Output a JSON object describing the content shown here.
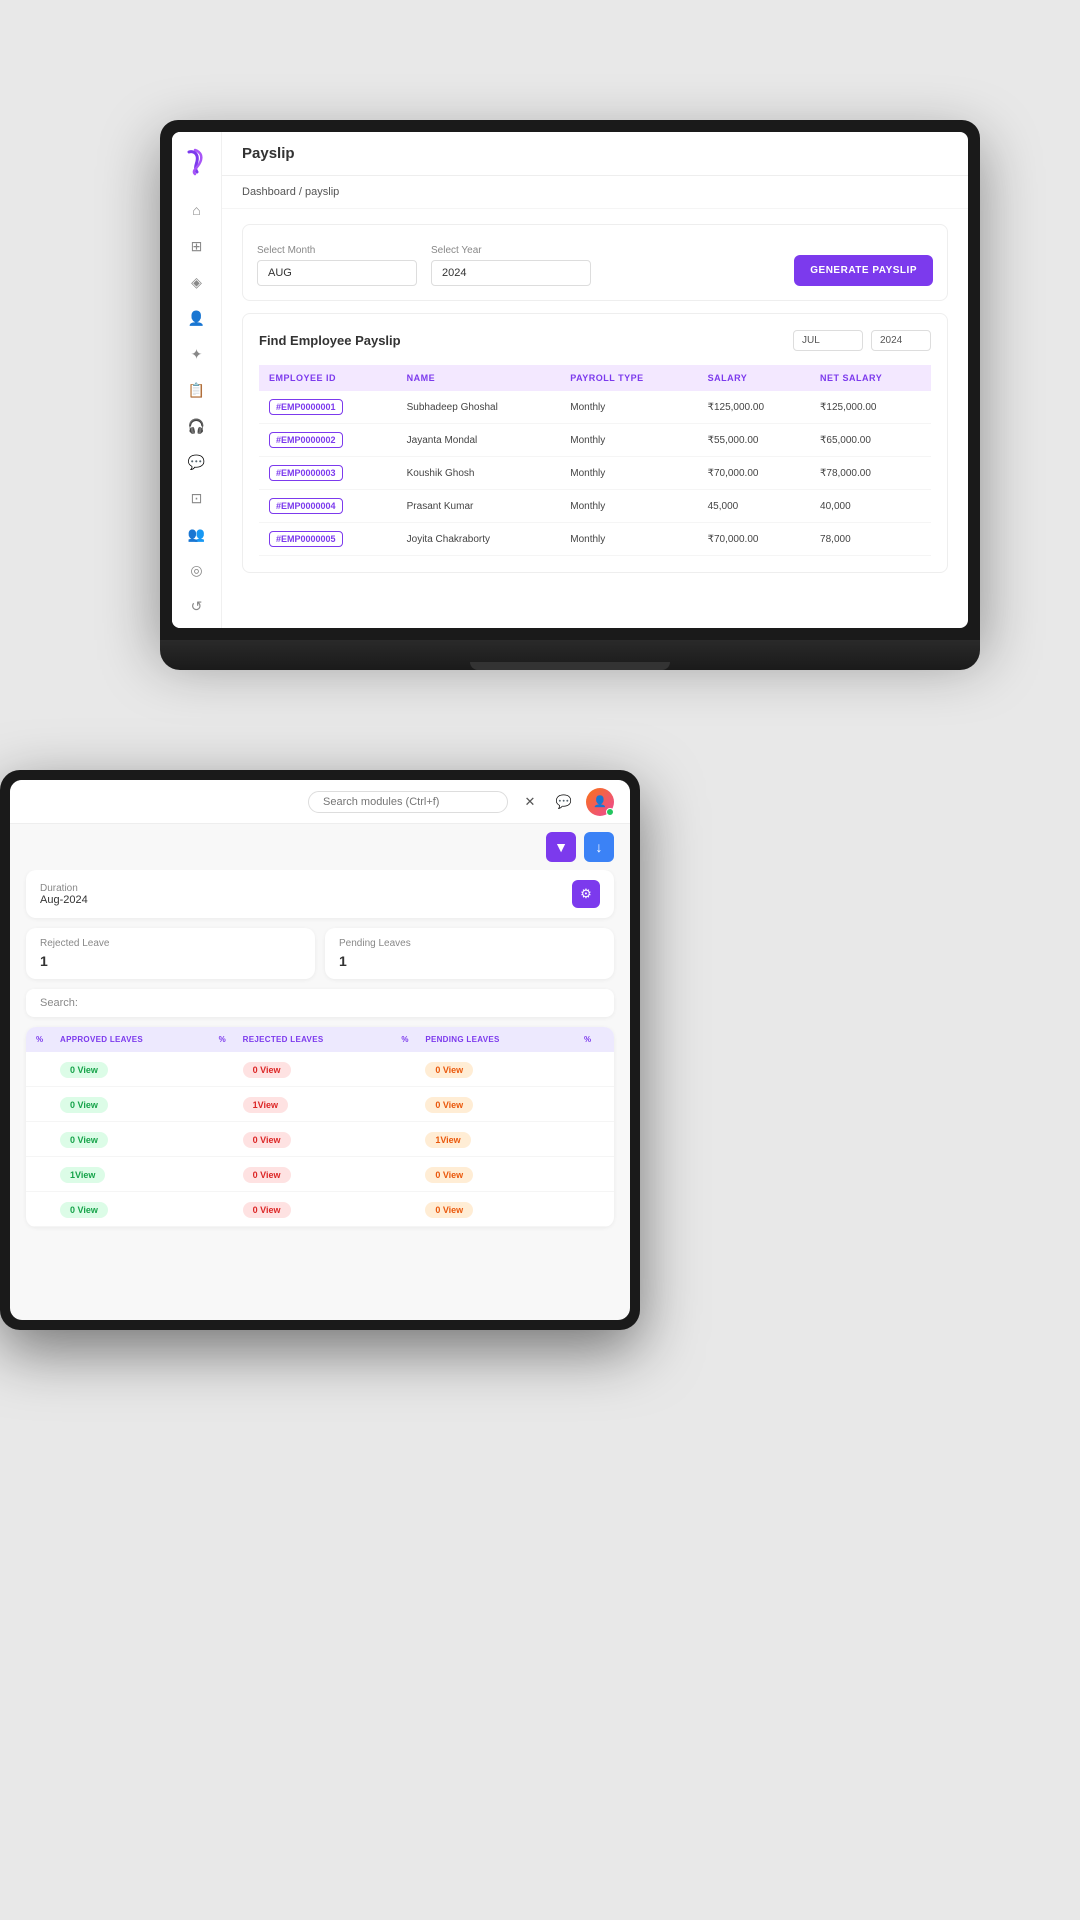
{
  "laptop": {
    "title": "Payslip",
    "breadcrumb": {
      "home": "Dashboard",
      "separator": "/",
      "current": "payslip"
    },
    "filters": {
      "select_month_label": "Select Month",
      "select_year_label": "Select Year",
      "month_value": "AUG",
      "year_value": "2024",
      "generate_btn": "GENERATE PAYSLIP"
    },
    "payslip_section": {
      "title": "Find Employee Payslip",
      "filter_month": "JUL",
      "filter_year": "2024"
    },
    "table": {
      "columns": [
        "EMPLOYEE ID",
        "NAME",
        "PAYROLL TYPE",
        "SALARY",
        "NET SALARY"
      ],
      "rows": [
        {
          "id": "#EMP0000001",
          "name": "Subhadeep Ghoshal",
          "type": "Monthly",
          "salary": "₹125,000.00",
          "net": "₹125,000.00"
        },
        {
          "id": "#EMP0000002",
          "name": "Jayanta Mondal",
          "type": "Monthly",
          "salary": "₹55,000.00",
          "net": "₹65,000.00"
        },
        {
          "id": "#EMP0000003",
          "name": "Koushik Ghosh",
          "type": "Monthly",
          "salary": "₹70,000.00",
          "net": "₹78,000.00"
        },
        {
          "id": "#EMP0000004",
          "name": "Prasant Kumar",
          "type": "Monthly",
          "salary": "45,000",
          "net": "40,000"
        },
        {
          "id": "#EMP0000005",
          "name": "Joyita Chakraborty",
          "type": "Monthly",
          "salary": "₹70,000.00",
          "net": "78,000"
        }
      ]
    }
  },
  "tablet": {
    "search_placeholder": "Search modules (Ctrl+f)",
    "filter_btn_label": "Filter",
    "download_btn_label": "Download",
    "duration": {
      "label": "Duration",
      "value": "Aug-2024"
    },
    "stats": {
      "rejected": {
        "title": "Rejected Leave",
        "value": "1"
      },
      "pending": {
        "title": "Pending Leaves",
        "value": "1"
      }
    },
    "search_label": "Search:",
    "leave_table": {
      "columns": [
        "%",
        "APPROVED LEAVES",
        "%",
        "REJECTED LEAVES",
        "%",
        "PENDING LEAVES",
        "%"
      ],
      "columns_display": [
        "",
        "APPROVED LEAVES",
        "",
        "REJECTED LEAVES",
        "",
        "PENDING LEAVES",
        ""
      ],
      "rows": [
        {
          "approved": "0 View",
          "rejected": "0 View",
          "pending": "0 View"
        },
        {
          "approved": "0 View",
          "rejected": "1View",
          "pending": "0 View"
        },
        {
          "approved": "0 View",
          "rejected": "0 View",
          "pending": "1View"
        },
        {
          "approved": "1View",
          "rejected": "0 View",
          "pending": "0 View"
        },
        {
          "approved": "0 View",
          "rejected": "0 View",
          "pending": "0 View"
        }
      ]
    }
  },
  "sidebar": {
    "items": [
      {
        "icon": "⌂",
        "name": "home"
      },
      {
        "icon": "⊞",
        "name": "dashboard"
      },
      {
        "icon": "◈",
        "name": "filter"
      },
      {
        "icon": "👤",
        "name": "person"
      },
      {
        "icon": "✦",
        "name": "star"
      },
      {
        "icon": "📋",
        "name": "list"
      },
      {
        "icon": "🎧",
        "name": "headphones"
      },
      {
        "icon": "💬",
        "name": "chat"
      },
      {
        "icon": "⊡",
        "name": "grid"
      },
      {
        "icon": "👥",
        "name": "users"
      },
      {
        "icon": "◎",
        "name": "target"
      },
      {
        "icon": "↺",
        "name": "refresh"
      }
    ]
  }
}
